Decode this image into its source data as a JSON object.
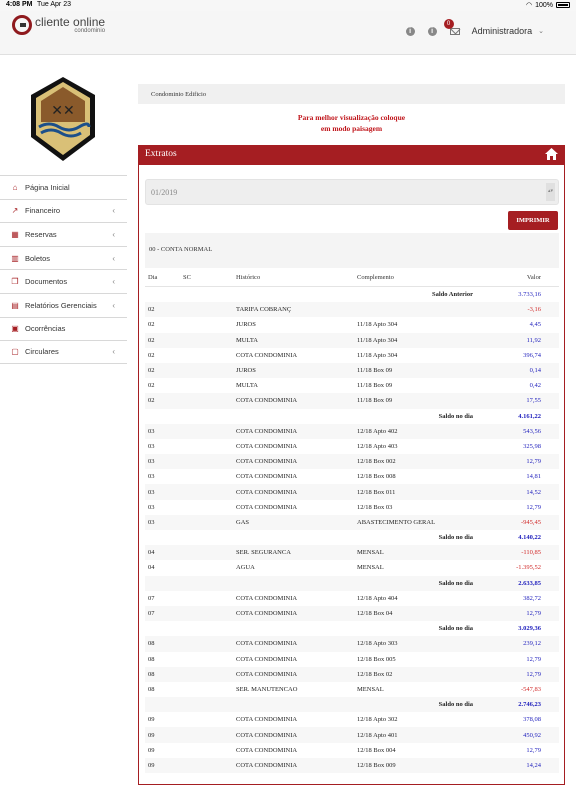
{
  "status_bar": {
    "time": "4:08 PM",
    "date": "Tue Apr 23",
    "battery": "100%"
  },
  "header": {
    "logo_main": "cliente online",
    "logo_sub": "condominio",
    "badge_count": "0",
    "user_name": "Administradora"
  },
  "sidebar": {
    "items": [
      {
        "label": "Página Inicial",
        "icon": "home-icon",
        "arrow": ""
      },
      {
        "label": "Financeiro",
        "icon": "chart-icon",
        "arrow": "‹"
      },
      {
        "label": "Reservas",
        "icon": "calendar-icon",
        "arrow": "‹"
      },
      {
        "label": "Boletos",
        "icon": "barcode-icon",
        "arrow": "‹"
      },
      {
        "label": "Documentos",
        "icon": "documents-icon",
        "arrow": "‹"
      },
      {
        "label": "Relatórios Gerenciais",
        "icon": "report-icon",
        "arrow": "‹"
      },
      {
        "label": "Ocorrências",
        "icon": "alert-icon",
        "arrow": ""
      },
      {
        "label": "Circulares",
        "icon": "circular-icon",
        "arrow": "‹"
      }
    ]
  },
  "main": {
    "breadcrumb": "Condominio Edificio",
    "notice_line1": "Para melhor visualização coloque",
    "notice_line2": "em modo paisagem",
    "panel_title": "Extratos",
    "period": "01/2019",
    "print_label": "IMPRIMIR",
    "account": "00 - CONTA NORMAL",
    "columns": {
      "dia": "Dia",
      "sc": "SC",
      "hist": "Histórico",
      "comp": "Complemento",
      "val": "Valor"
    },
    "rows": [
      {
        "type": "saldo",
        "label": "Saldo Anterior",
        "value": "3.733,16",
        "bold": false
      },
      {
        "dia": "02",
        "hist": "TARIFA COBRANÇ",
        "comp": "",
        "value": "-3,16"
      },
      {
        "dia": "02",
        "hist": "JUROS",
        "comp": "11/18 Apto 304",
        "value": "4,45"
      },
      {
        "dia": "02",
        "hist": "MULTA",
        "comp": "11/18 Apto 304",
        "value": "11,92"
      },
      {
        "dia": "02",
        "hist": "COTA CONDOMINIA",
        "comp": "11/18 Apto 304",
        "value": "396,74"
      },
      {
        "dia": "02",
        "hist": "JUROS",
        "comp": "11/18 Box 09",
        "value": "0,14"
      },
      {
        "dia": "02",
        "hist": "MULTA",
        "comp": "11/18 Box 09",
        "value": "0,42"
      },
      {
        "dia": "02",
        "hist": "COTA CONDOMINIA",
        "comp": "11/18 Box 09",
        "value": "17,55"
      },
      {
        "type": "saldo",
        "label": "Saldo no dia",
        "value": "4.161,22",
        "bold": true
      },
      {
        "dia": "03",
        "hist": "COTA CONDOMINIA",
        "comp": "12/18 Apto 402",
        "value": "543,56"
      },
      {
        "dia": "03",
        "hist": "COTA CONDOMINIA",
        "comp": "12/18 Apto 403",
        "value": "325,98"
      },
      {
        "dia": "03",
        "hist": "COTA CONDOMINIA",
        "comp": "12/18 Box 002",
        "value": "12,79"
      },
      {
        "dia": "03",
        "hist": "COTA CONDOMINIA",
        "comp": "12/18 Box 008",
        "value": "14,81"
      },
      {
        "dia": "03",
        "hist": "COTA CONDOMINIA",
        "comp": "12/18 Box 011",
        "value": "14,52"
      },
      {
        "dia": "03",
        "hist": "COTA CONDOMINIA",
        "comp": "12/18 Box 03",
        "value": "12,79"
      },
      {
        "dia": "03",
        "hist": "GAS",
        "comp": "ABASTECIMENTO GERAL",
        "value": "-945,45"
      },
      {
        "type": "saldo",
        "label": "Saldo no dia",
        "value": "4.140,22",
        "bold": true
      },
      {
        "dia": "04",
        "hist": "SER. SEGURANCA",
        "comp": "MENSAL",
        "value": "-110,85"
      },
      {
        "dia": "04",
        "hist": "AGUA",
        "comp": "MENSAL",
        "value": "-1.395,52"
      },
      {
        "type": "saldo",
        "label": "Saldo no dia",
        "value": "2.633,85",
        "bold": true
      },
      {
        "dia": "07",
        "hist": "COTA CONDOMINIA",
        "comp": "12/18 Apto 404",
        "value": "382,72"
      },
      {
        "dia": "07",
        "hist": "COTA CONDOMINIA",
        "comp": "12/18 Box 04",
        "value": "12,79"
      },
      {
        "type": "saldo",
        "label": "Saldo no dia",
        "value": "3.029,36",
        "bold": true
      },
      {
        "dia": "08",
        "hist": "COTA CONDOMINIA",
        "comp": "12/18 Apto 303",
        "value": "239,12"
      },
      {
        "dia": "08",
        "hist": "COTA CONDOMINIA",
        "comp": "12/18 Box 005",
        "value": "12,79"
      },
      {
        "dia": "08",
        "hist": "COTA CONDOMINIA",
        "comp": "12/18 Box 02",
        "value": "12,79"
      },
      {
        "dia": "08",
        "hist": "SER. MANUTENCAO",
        "comp": "MENSAL",
        "value": "-547,83"
      },
      {
        "type": "saldo",
        "label": "Saldo no dia",
        "value": "2.746,23",
        "bold": true
      },
      {
        "dia": "09",
        "hist": "COTA CONDOMINIA",
        "comp": "12/18 Apto 302",
        "value": "378,08"
      },
      {
        "dia": "09",
        "hist": "COTA CONDOMINIA",
        "comp": "12/18 Apto 401",
        "value": "450,92"
      },
      {
        "dia": "09",
        "hist": "COTA CONDOMINIA",
        "comp": "12/18 Box 004",
        "value": "12,79"
      },
      {
        "dia": "09",
        "hist": "COTA CONDOMINIA",
        "comp": "12/18 Box 009",
        "value": "14,24"
      }
    ]
  }
}
